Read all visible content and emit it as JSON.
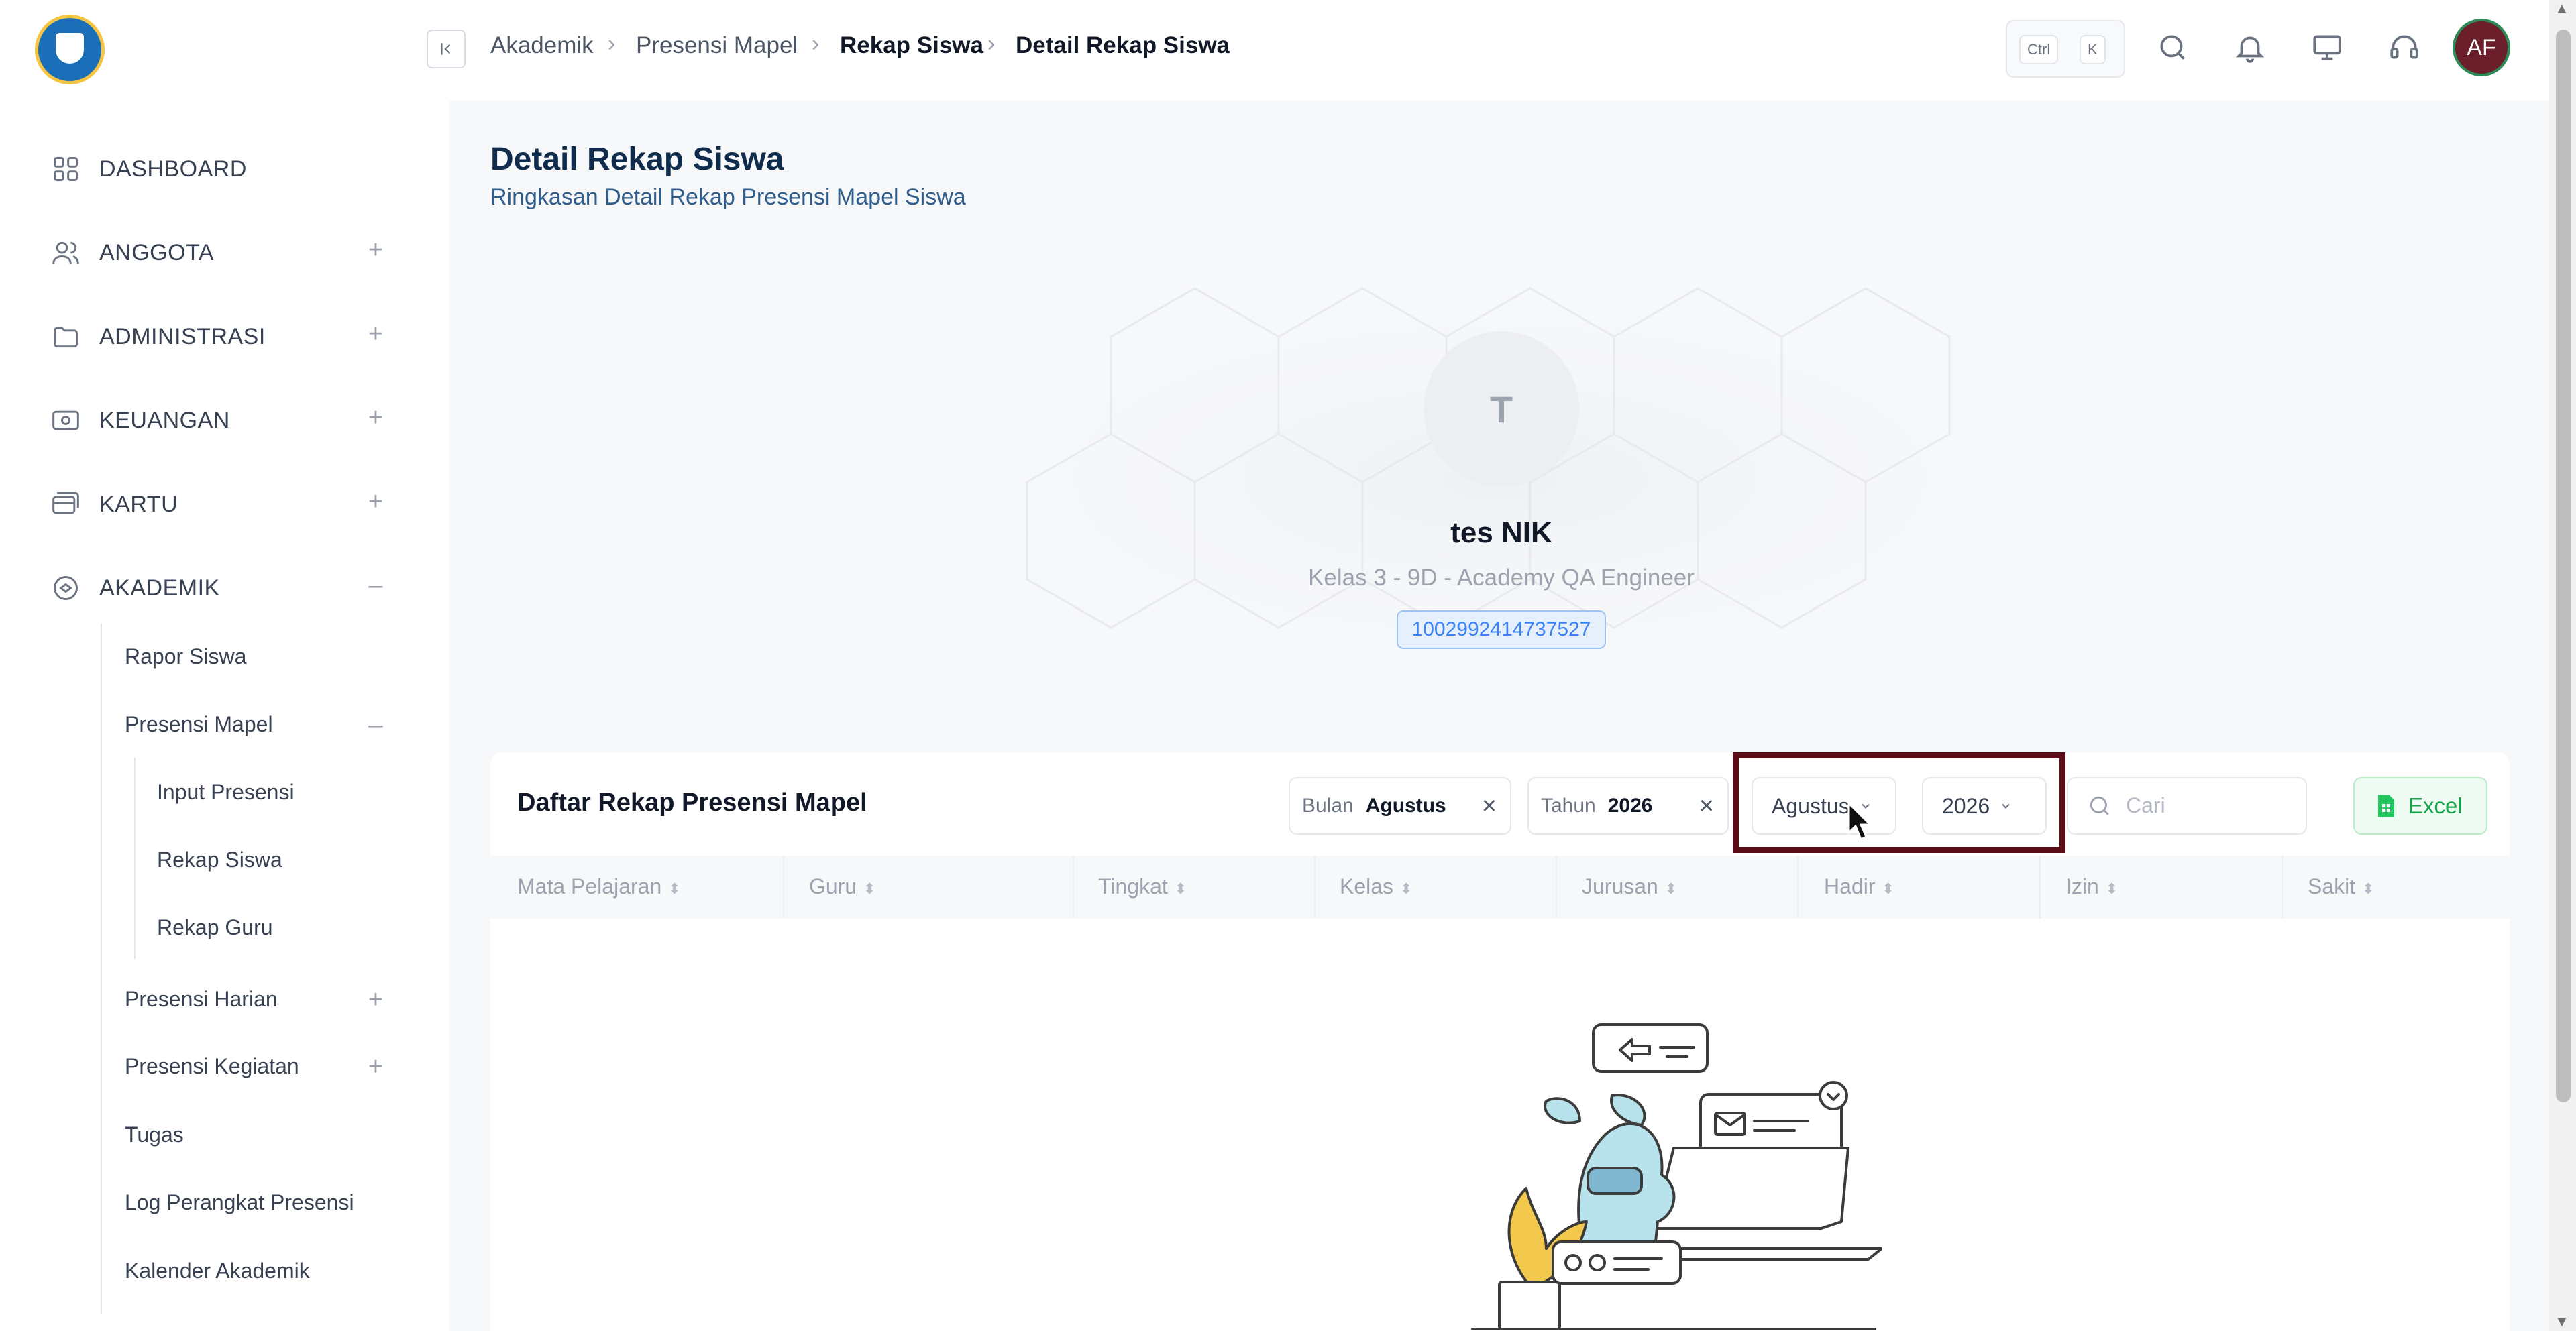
{
  "sidebar": {
    "items": [
      {
        "label": "DASHBOARD",
        "icon": "dashboard-grid-icon",
        "expander": ""
      },
      {
        "label": "ANGGOTA",
        "icon": "users-icon",
        "expander": "+"
      },
      {
        "label": "ADMINISTRASI",
        "icon": "folder-icon",
        "expander": "+"
      },
      {
        "label": "KEUANGAN",
        "icon": "money-icon",
        "expander": "+"
      },
      {
        "label": "KARTU",
        "icon": "card-icon",
        "expander": "+"
      },
      {
        "label": "AKADEMIK",
        "icon": "academic-icon",
        "expander": "–"
      }
    ],
    "akademik_sub": [
      {
        "label": "Rapor Siswa",
        "expander": ""
      },
      {
        "label": "Presensi Mapel",
        "expander": "–"
      },
      {
        "label": "Presensi Harian",
        "expander": "+"
      },
      {
        "label": "Presensi Kegiatan",
        "expander": "+"
      },
      {
        "label": "Tugas",
        "expander": ""
      },
      {
        "label": "Log Perangkat Presensi",
        "expander": ""
      },
      {
        "label": "Kalender Akademik",
        "expander": ""
      }
    ],
    "presensi_mapel_sub": [
      "Input Presensi",
      "Rekap Siswa",
      "Rekap Guru"
    ]
  },
  "header": {
    "breadcrumb": [
      "Akademik",
      "Presensi Mapel",
      "Rekap Siswa",
      "Detail Rekap Siswa"
    ],
    "shortcut": [
      "Ctrl",
      "K"
    ],
    "avatar_initials": "AF",
    "icons": [
      "search-icon",
      "bell-icon",
      "monitor-icon",
      "headset-icon"
    ]
  },
  "page": {
    "title": "Detail Rekap Siswa",
    "subtitle": "Ringkasan Detail Rekap Presensi Mapel Siswa"
  },
  "profile": {
    "initial": "T",
    "name": "tes NIK",
    "class": "Kelas 3 - 9D - Academy QA Engineer",
    "id": "1002992414737527"
  },
  "table_card": {
    "title": "Daftar Rekap Presensi Mapel",
    "filters": [
      {
        "label": "Bulan",
        "value": "Agustus"
      },
      {
        "label": "Tahun",
        "value": "2026"
      }
    ],
    "month_select": "Agustus",
    "year_select": "2026",
    "search_placeholder": "Cari",
    "export_label": "Excel",
    "columns": [
      "Mata Pelajaran",
      "Guru",
      "Tingkat",
      "Kelas",
      "Jurusan",
      "Hadir",
      "Izin",
      "Sakit"
    ],
    "rows": []
  },
  "colors": {
    "accent": "#0f2c4c",
    "highlight": "#5a0d16",
    "excel_green": "#16a34a",
    "id_blue": "#3b82f6"
  }
}
